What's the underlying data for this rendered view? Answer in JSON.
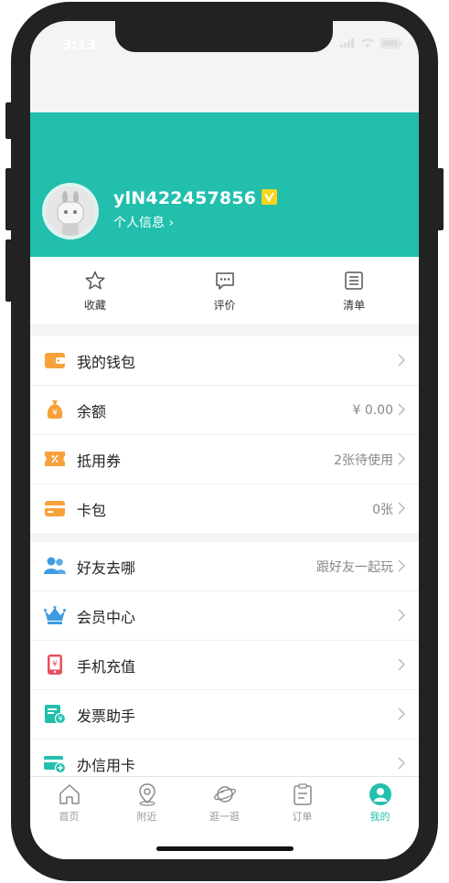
{
  "status": {
    "time": "3:13"
  },
  "profile": {
    "username": "ylN422457856",
    "profile_link": "个人信息 ›"
  },
  "quick": [
    {
      "label": "收藏",
      "icon": "star-icon"
    },
    {
      "label": "评价",
      "icon": "comment-icon"
    },
    {
      "label": "清单",
      "icon": "list-icon"
    }
  ],
  "wallet_group": [
    {
      "label": "我的钱包",
      "value": "",
      "icon": "wallet-icon"
    },
    {
      "label": "余额",
      "value": "¥ 0.00",
      "icon": "money-bag-icon"
    },
    {
      "label": "抵用券",
      "value": "2张待使用",
      "icon": "coupon-icon"
    },
    {
      "label": "卡包",
      "value": "0张",
      "icon": "card-icon"
    }
  ],
  "service_group": [
    {
      "label": "好友去哪",
      "value": "跟好友一起玩",
      "icon": "friends-icon"
    },
    {
      "label": "会员中心",
      "value": "",
      "icon": "crown-icon"
    },
    {
      "label": "手机充值",
      "value": "",
      "icon": "phone-recharge-icon"
    },
    {
      "label": "发票助手",
      "value": "",
      "icon": "invoice-icon"
    },
    {
      "label": "办信用卡",
      "value": "",
      "icon": "credit-card-icon"
    }
  ],
  "tabs": [
    {
      "label": "首页",
      "icon": "home-icon",
      "active": false
    },
    {
      "label": "附近",
      "icon": "location-icon",
      "active": false
    },
    {
      "label": "逛一逛",
      "icon": "planet-icon",
      "active": false
    },
    {
      "label": "订单",
      "icon": "order-icon",
      "active": false
    },
    {
      "label": "我的",
      "icon": "profile-icon",
      "active": true
    }
  ],
  "colors": {
    "accent": "#22bfad",
    "orange": "#f7a13a",
    "blue": "#3e9be0",
    "red": "#e8505b",
    "badge": "#f7d51d"
  }
}
